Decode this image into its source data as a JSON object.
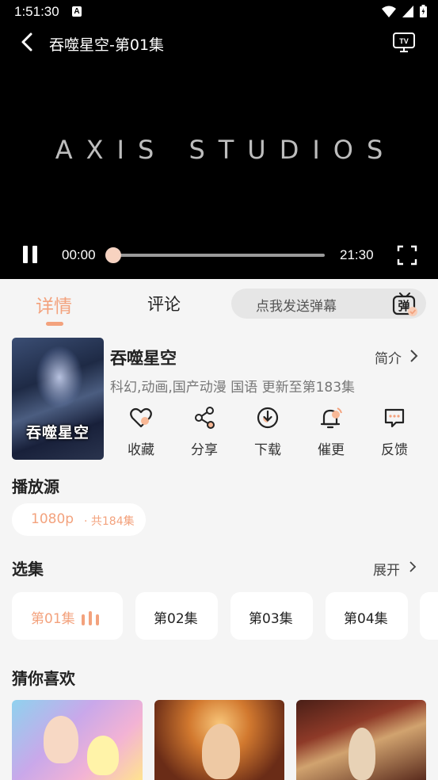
{
  "status_bar": {
    "time": "1:51:30",
    "badge": "A"
  },
  "player": {
    "title": "吞噬星空-第01集",
    "watermark": "AXIS STUDIOS",
    "current_time": "00:00",
    "total_time": "21:30",
    "progress": 0.0
  },
  "tabs": {
    "details": "详情",
    "comments": "评论"
  },
  "danmaku": {
    "placeholder": "点我发送弹幕",
    "icon_char": "弹"
  },
  "show": {
    "title": "吞噬星空",
    "intro_label": "简介",
    "meta": "科幻,动画,国产动漫 国语 更新至第183集",
    "poster_text": "吞噬星空"
  },
  "actions": [
    {
      "label": "收藏",
      "icon": "heart-icon"
    },
    {
      "label": "分享",
      "icon": "share-icon"
    },
    {
      "label": "下载",
      "icon": "download-icon"
    },
    {
      "label": "催更",
      "icon": "bell-icon"
    },
    {
      "label": "反馈",
      "icon": "feedback-icon"
    }
  ],
  "source": {
    "title": "播放源",
    "quality": "1080p",
    "count": "· 共184集"
  },
  "episodes": {
    "title": "选集",
    "expand_label": "展开",
    "items": [
      "第01集",
      "第02集",
      "第03集",
      "第04集"
    ]
  },
  "recommend": {
    "title": "猜你喜欢"
  },
  "colors": {
    "accent": "#f3a27d",
    "background": "#f5f5f5"
  }
}
